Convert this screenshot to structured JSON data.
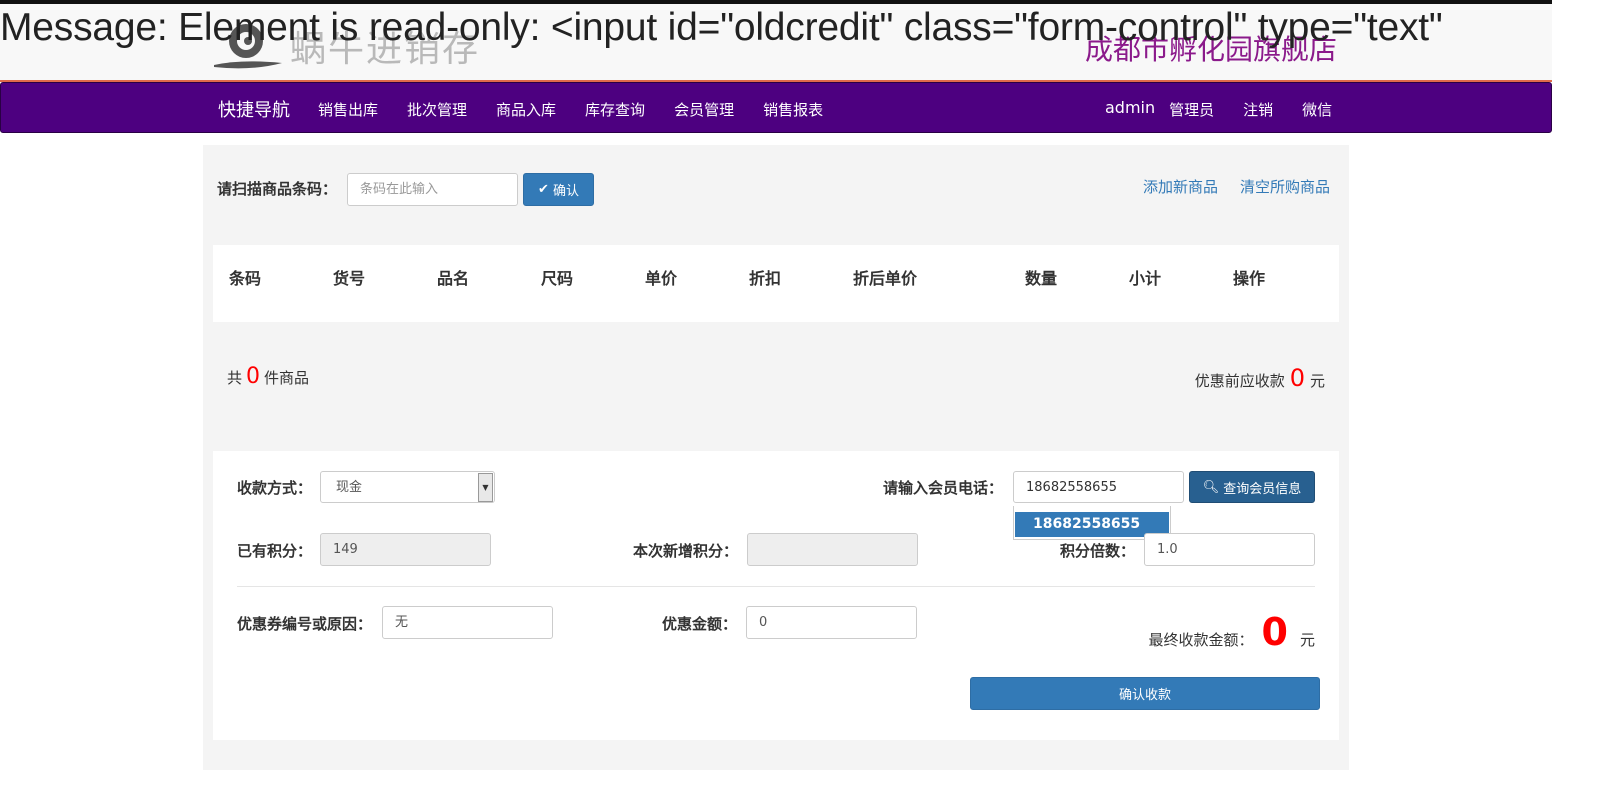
{
  "header": {
    "logo_text": "蜗牛进销存",
    "store_name": "成都市孵化园旗舰店"
  },
  "error_message": "Message: Element is read-only: <input id=\"oldcredit\" class=\"form-control\" type=\"text\"",
  "nav": {
    "brand": "快捷导航",
    "items": [
      "销售出库",
      "批次管理",
      "商品入库",
      "库存查询",
      "会员管理",
      "销售报表"
    ],
    "user": "admin",
    "role": "管理员",
    "logout": "注销",
    "wechat": "微信"
  },
  "scan": {
    "label": "请扫描商品条码：",
    "placeholder": "条码在此输入",
    "confirm": "确认",
    "add_product": "添加新商品",
    "clear_products": "清空所购商品"
  },
  "table": {
    "columns": [
      "条码",
      "货号",
      "品名",
      "尺码",
      "单价",
      "折扣",
      "折后单价",
      "数量",
      "小计",
      "操作"
    ]
  },
  "summary": {
    "prefix": "共",
    "count": "0",
    "suffix": "件商品",
    "due_label": "优惠前应收款",
    "due_amount": "0",
    "currency": "元"
  },
  "payment": {
    "method_label": "收款方式：",
    "method_value": "现金",
    "phone_label": "请输入会员电话：",
    "phone_value": "18682558655",
    "query_button": "查询会员信息",
    "suggestion": "18682558655",
    "points_label": "已有积分：",
    "points_value": "149",
    "new_points_label": "本次新增积分：",
    "new_points_value": "",
    "multiplier_label": "积分倍数：",
    "multiplier_value": "1.0",
    "coupon_label": "优惠券编号或原因：",
    "coupon_value": "无",
    "discount_label": "优惠金额：",
    "discount_value": "0",
    "final_label": "最终收款金额：",
    "final_amount": "0",
    "currency": "元",
    "confirm_button": "确认收款"
  },
  "colors": {
    "nav_bg": "#4d0080",
    "primary": "#337ab7",
    "store_name": "#8b1a8b",
    "amount": "#ff0000"
  }
}
